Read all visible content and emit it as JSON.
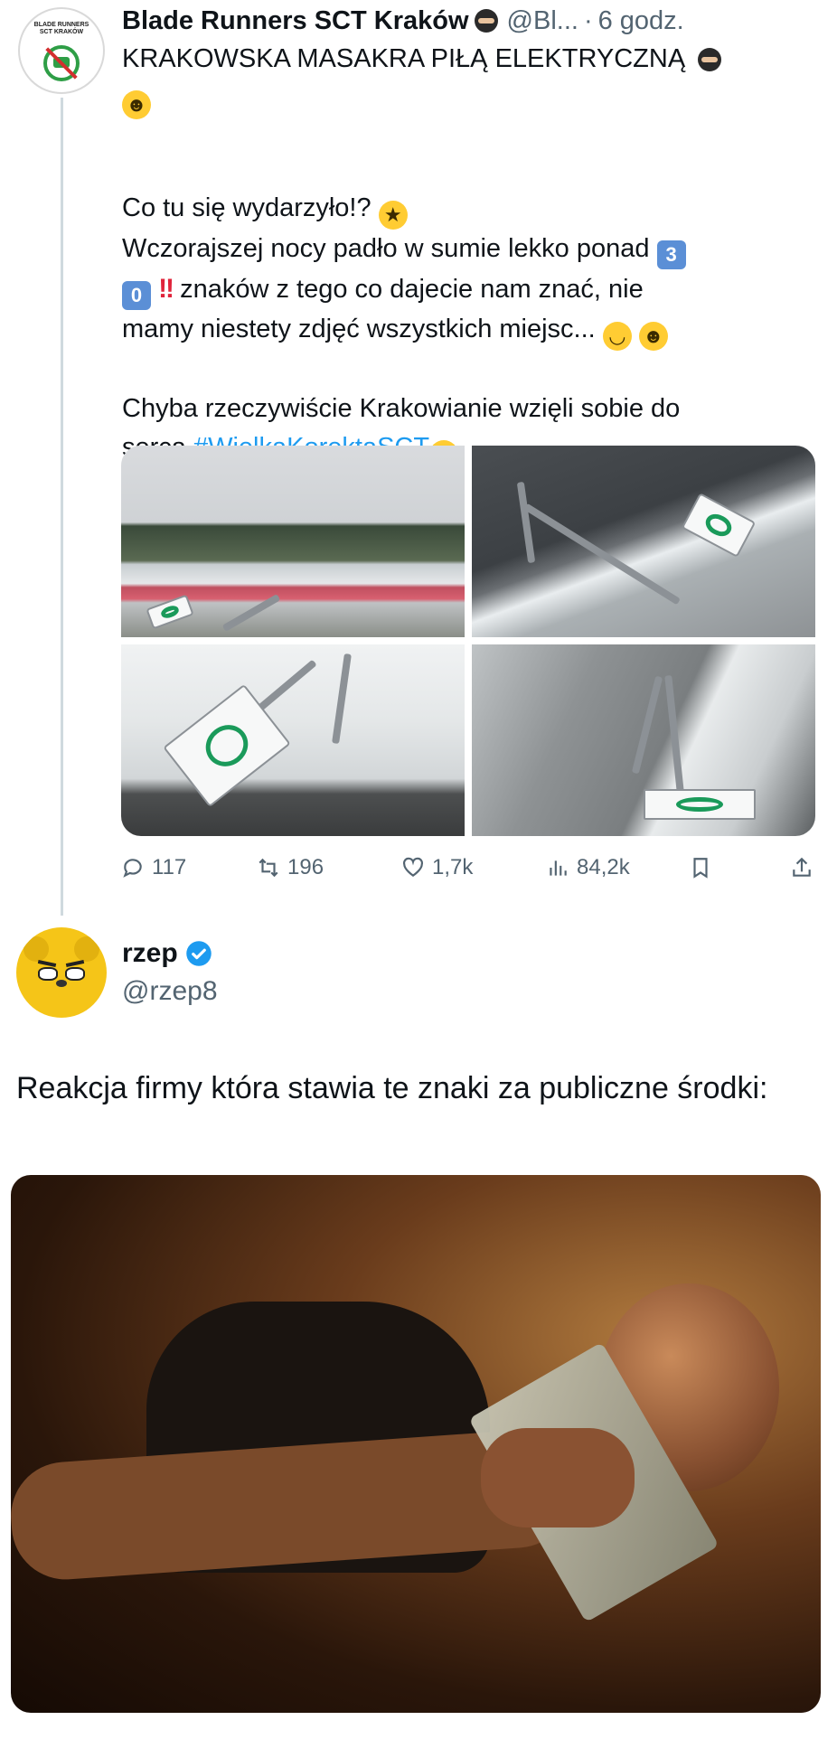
{
  "tweet1": {
    "name": "Blade Runners SCT Kraków",
    "handle": "@Bl...",
    "dot": "·",
    "time": "6 godz.",
    "avatar_lines": [
      "BLADE RUNNERS",
      "SCT KRAKÓW"
    ],
    "line1": "KRAKOWSKA MASAKRA PIŁĄ ELEKTRYCZNĄ",
    "line2": "Co tu się wydarzyło!?",
    "line3a": "Wczorajszej nocy padło w sumie lekko ponad",
    "keycap1": "3",
    "keycap2": "0",
    "bang": "!!",
    "line4": "znaków z tego co dajecie nam znać, nie",
    "line5": "mamy niestety zdjęć wszystkich miejsc...",
    "line6": "Chyba rzeczywiście Krakowianie wzięli sobie do",
    "line7a": "serca",
    "hashtag": "#WielkaKorektaSCT",
    "actions": {
      "replies": "117",
      "retweets": "196",
      "likes": "1,7k",
      "views": "84,2k"
    }
  },
  "tweet2": {
    "name": "rzep",
    "handle": "@rzep8",
    "text": "Reakcja firmy która stawia te znaki za publiczne środki:"
  },
  "colors": {
    "accent": "#1d9bf0",
    "muted": "#536471",
    "thread_line": "#cfd9de"
  },
  "icons": [
    "reply-icon",
    "retweet-icon",
    "like-icon",
    "views-icon",
    "bookmark-icon",
    "share-icon",
    "verified-icon",
    "ninja-emoji",
    "smile-emoji"
  ]
}
